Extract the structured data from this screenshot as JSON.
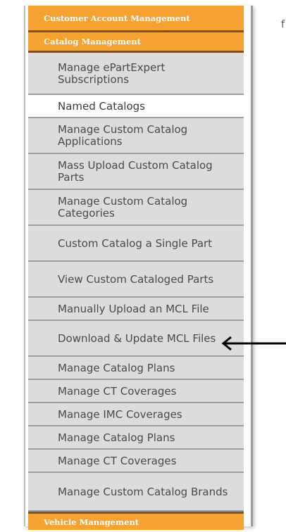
{
  "menu": {
    "customer_header": "Customer Account Management",
    "catalog_header": "Catalog Management",
    "vehicle_header": "Vehicle Management",
    "items": [
      {
        "label": "Manage ePartExpert Subscriptions"
      },
      {
        "label": "Named Catalogs"
      },
      {
        "label": "Manage Custom Catalog Applications"
      },
      {
        "label": "Mass Upload Custom Catalog Parts"
      },
      {
        "label": "Manage Custom Catalog Categories"
      },
      {
        "label": "Custom Catalog a Single Part"
      },
      {
        "label": "View Custom Cataloged Parts"
      },
      {
        "label": "Manually Upload an MCL File"
      },
      {
        "label": "Download & Update MCL Files"
      },
      {
        "label": "Manage Catalog Plans"
      },
      {
        "label": "Manage CT Coverages"
      },
      {
        "label": "Manage IMC Coverages"
      },
      {
        "label": "Manage Catalog Plans"
      },
      {
        "label": "Manage CT Coverages"
      },
      {
        "label": "Manage Custom Catalog Brands"
      }
    ],
    "selected_item": "Named Catalogs"
  },
  "colors": {
    "header_orange": "#f5a233",
    "header_border": "#7d5126",
    "item_gray": "#dcdcdc",
    "selected_white": "#ffffff"
  },
  "icons": {
    "pointer": "arrow-left-icon"
  },
  "cutoff_text": "f"
}
